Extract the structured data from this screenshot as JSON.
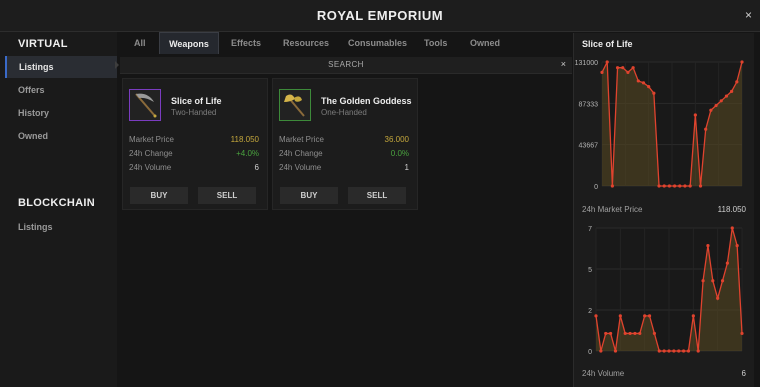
{
  "window": {
    "title": "ROYAL EMPORIUM",
    "close_icon": "×"
  },
  "sidebar": {
    "virtual_heading": "VIRTUAL",
    "virtual_items": [
      "Listings",
      "Offers",
      "History",
      "Owned"
    ],
    "active_item": "Listings",
    "blockchain_heading": "BLOCKCHAIN",
    "blockchain_items": [
      "Listings"
    ]
  },
  "tabs": [
    "All",
    "Weapons",
    "Effects",
    "Resources",
    "Consumables",
    "Tools",
    "Owned"
  ],
  "active_tab": "Weapons",
  "search": {
    "label": "SEARCH",
    "clear_icon": "×"
  },
  "cards": [
    {
      "name": "Slice of Life",
      "subtitle": "Two-Handed",
      "icon": "scythe-icon",
      "price_label": "Market Price",
      "price": "118.050",
      "change_label": "24h Change",
      "change": "+4.0%",
      "volume_label": "24h Volume",
      "volume": "6",
      "buy_label": "BUY",
      "sell_label": "SELL"
    },
    {
      "name": "The Golden Goddess",
      "subtitle": "One-Handed",
      "icon": "golden-axe-icon",
      "price_label": "Market Price",
      "price": "36.000",
      "change_label": "24h Change",
      "change": "0.0%",
      "volume_label": "24h Volume",
      "volume": "1",
      "buy_label": "BUY",
      "sell_label": "SELL"
    }
  ],
  "colors": {
    "accent": "#3a6ac8",
    "price": "#c4a73c",
    "change_positive": "#4aa33f",
    "chart_line": "#e0432e",
    "chart_fill": "#5a4a22"
  },
  "detail": {
    "title": "Slice of Life",
    "price_footer_label": "24h Market Price",
    "price_footer_value": "118.050",
    "volume_footer_label": "24h Volume",
    "volume_footer_value": "6"
  },
  "chart_data": [
    {
      "type": "area",
      "series": [
        {
          "values": [
            120000,
            131000,
            0,
            125000,
            125000,
            120000,
            125000,
            111000,
            109000,
            105000,
            98000,
            0,
            0,
            0,
            0,
            0,
            0,
            0,
            75000,
            0,
            60000,
            80000,
            85000,
            90000,
            95000,
            100000,
            110000,
            131000
          ]
        }
      ],
      "yticks": [
        "0",
        "43667",
        "87333",
        "131000"
      ],
      "ylim": [
        0,
        131000
      ],
      "grid": true
    },
    {
      "type": "area",
      "series": [
        {
          "values": [
            2,
            0,
            1,
            1,
            0,
            2,
            1,
            1,
            1,
            1,
            2,
            2,
            1,
            0,
            0,
            0,
            0,
            0,
            0,
            0,
            2,
            0,
            4,
            6,
            4,
            3,
            4,
            5,
            7,
            6,
            1
          ]
        }
      ],
      "yticks": [
        "0",
        "2",
        "5",
        "7"
      ],
      "ylim": [
        0,
        7
      ],
      "grid": true
    }
  ]
}
